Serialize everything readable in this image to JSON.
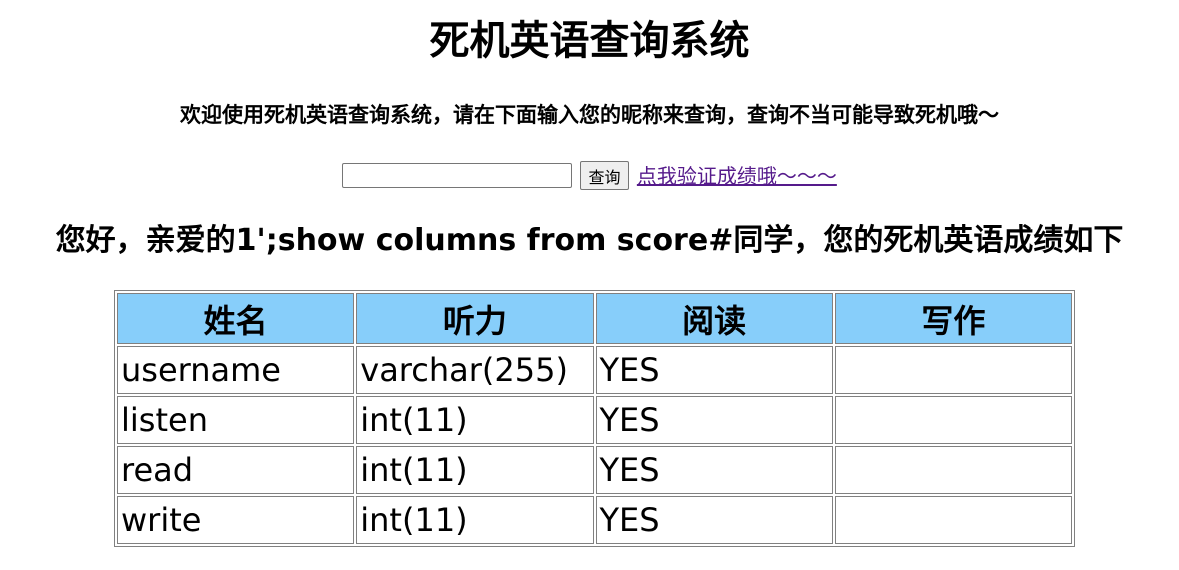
{
  "page": {
    "title": "死机英语查询系统",
    "welcome": "欢迎使用死机英语查询系统，请在下面输入您的昵称来查询，查询不当可能导致死机哦～",
    "greeting": "您好，亲爱的1';show columns from score#同学，您的死机英语成绩如下"
  },
  "search": {
    "input_value": "",
    "placeholder": "",
    "button_label": "查询",
    "verify_link": "点我验证成绩哦～～～"
  },
  "table": {
    "headers": [
      "姓名",
      "听力",
      "阅读",
      "写作"
    ],
    "rows": [
      [
        "username",
        "varchar(255)",
        "YES",
        ""
      ],
      [
        "listen",
        "int(11)",
        "YES",
        ""
      ],
      [
        "read",
        "int(11)",
        "YES",
        ""
      ],
      [
        "write",
        "int(11)",
        "YES",
        ""
      ]
    ]
  },
  "colors": {
    "header_bg": "#87cefa",
    "link": "#551a8b"
  }
}
